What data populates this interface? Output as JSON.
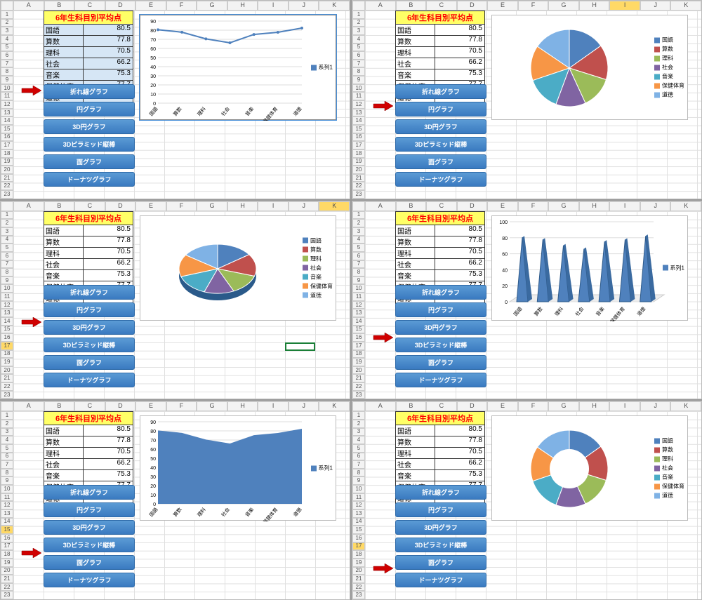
{
  "columns": [
    "A",
    "B",
    "C",
    "D",
    "E",
    "F",
    "G",
    "H",
    "I",
    "J",
    "K"
  ],
  "rows": [
    "1",
    "2",
    "3",
    "4",
    "5",
    "6",
    "7",
    "8",
    "9",
    "10",
    "11",
    "12",
    "13",
    "14",
    "15",
    "16",
    "17",
    "18",
    "19",
    "20",
    "21",
    "22",
    "23"
  ],
  "table": {
    "title": "6年生科目別平均点",
    "rows": [
      {
        "label": "国語",
        "value": "80.5"
      },
      {
        "label": "算数",
        "value": "77.8"
      },
      {
        "label": "理科",
        "value": "70.5"
      },
      {
        "label": "社会",
        "value": "66.2"
      },
      {
        "label": "音楽",
        "value": "75.3"
      },
      {
        "label": "保健体育",
        "value": "77.7"
      },
      {
        "label": "道徳",
        "value": "82.3"
      }
    ]
  },
  "buttons": [
    "折れ線グラフ",
    "円グラフ",
    "3D円グラフ",
    "3Dピラミッド縦棒",
    "面グラフ",
    "ドーナツグラフ"
  ],
  "series_label": "系列1",
  "colors": [
    "#4f81bd",
    "#c0504d",
    "#9bbb59",
    "#8064a2",
    "#4bacc6",
    "#f79646",
    "#7fb2e5"
  ],
  "chart_data": [
    {
      "type": "line",
      "categories": [
        "国語",
        "算数",
        "理科",
        "社会",
        "音楽",
        "保健体育",
        "道徳"
      ],
      "series": [
        {
          "name": "系列1",
          "values": [
            80.5,
            77.8,
            70.5,
            66.2,
            75.3,
            77.7,
            82.3
          ]
        }
      ],
      "ylim": [
        0,
        90
      ],
      "yticks": [
        0,
        10,
        20,
        30,
        40,
        50,
        60,
        70,
        80,
        90
      ]
    },
    {
      "type": "pie",
      "categories": [
        "国語",
        "算数",
        "理科",
        "社会",
        "音楽",
        "保健体育",
        "道徳"
      ],
      "values": [
        80.5,
        77.8,
        70.5,
        66.2,
        75.3,
        77.7,
        82.3
      ]
    },
    {
      "type": "pie3d",
      "categories": [
        "国語",
        "算数",
        "理科",
        "社会",
        "音楽",
        "保健体育",
        "道徳"
      ],
      "values": [
        80.5,
        77.8,
        70.5,
        66.2,
        75.3,
        77.7,
        82.3
      ]
    },
    {
      "type": "pyramid3d",
      "categories": [
        "国語",
        "算数",
        "理科",
        "社会",
        "音楽",
        "保健体育",
        "道徳"
      ],
      "series": [
        {
          "name": "系列1",
          "values": [
            80.5,
            77.8,
            70.5,
            66.2,
            75.3,
            77.7,
            82.3
          ]
        }
      ],
      "ylim": [
        0,
        100
      ],
      "yticks": [
        0,
        20,
        40,
        60,
        80,
        100
      ]
    },
    {
      "type": "area",
      "categories": [
        "国語",
        "算数",
        "理科",
        "社会",
        "音楽",
        "保健体育",
        "道徳"
      ],
      "series": [
        {
          "name": "系列1",
          "values": [
            80.5,
            77.8,
            70.5,
            66.2,
            75.3,
            77.7,
            82.3
          ]
        }
      ],
      "ylim": [
        0,
        90
      ],
      "yticks": [
        0,
        10,
        20,
        30,
        40,
        50,
        60,
        70,
        80,
        90
      ]
    },
    {
      "type": "doughnut",
      "categories": [
        "国語",
        "算数",
        "理科",
        "社会",
        "音楽",
        "保健体育",
        "道徳"
      ],
      "values": [
        80.5,
        77.8,
        70.5,
        66.2,
        75.3,
        77.7,
        82.3
      ]
    }
  ],
  "panels": [
    {
      "arrow_btn": 0,
      "chart": 0,
      "legend_mode": "series",
      "chart_selected": true,
      "table_selected": true,
      "sel_col": null,
      "sel_row": null
    },
    {
      "arrow_btn": 1,
      "chart": 1,
      "legend_mode": "categories",
      "chart_selected": false,
      "sel_col": "I",
      "sel_row": null
    },
    {
      "arrow_btn": 2,
      "chart": 2,
      "legend_mode": "categories",
      "chart_selected": false,
      "sel_col": "K",
      "sel_row": "17",
      "sel_cell": {
        "c": 9,
        "r": 16
      }
    },
    {
      "arrow_btn": 3,
      "chart": 3,
      "legend_mode": "series",
      "chart_selected": false,
      "sel_col": null,
      "sel_row": null
    },
    {
      "arrow_btn": 4,
      "chart": 4,
      "legend_mode": "series",
      "chart_selected": false,
      "sel_col": null,
      "sel_row": "15"
    },
    {
      "arrow_btn": 5,
      "chart": 5,
      "legend_mode": "categories",
      "chart_selected": false,
      "sel_col": null,
      "sel_row": "17"
    }
  ]
}
